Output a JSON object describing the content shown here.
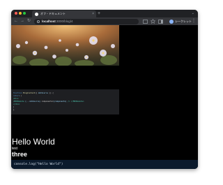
{
  "window": {
    "traffic_lights": {
      "close": "#ff5f57",
      "minimize": "#febc2e",
      "zoom": "#28c840"
    },
    "tab": {
      "title": "オフ・ドキュメント",
      "close_icon": "×"
    },
    "new_tab_icon": "+",
    "tab_menu_icon": "⌄"
  },
  "toolbar": {
    "back_icon": "←",
    "forward_icon": "→",
    "reload_icon": "↻",
    "address": {
      "host": "localhost",
      "port": ":3000/blog/4"
    },
    "profile_label": "シークレット",
    "menu_icon": "⋮"
  },
  "page": {
    "code": {
      "lines": [
        [
          {
            "t": "function",
            "c": "kw"
          },
          {
            "t": " BlogContent",
            "c": "fn"
          },
          {
            "t": "({ ",
            "c": "pu"
          },
          {
            "t": "mdxSource",
            "c": "tx"
          },
          {
            "t": " }) {",
            "c": "pu"
          }
        ],
        [
          {
            "t": "  return",
            "c": "kw"
          },
          {
            "t": " (",
            "c": "pu"
          }
        ],
        [
          {
            "t": "    <div>",
            "c": "tg"
          }
        ],
        [
          {
            "t": "      <MDXRemote",
            "c": "tg"
          },
          {
            "t": " {...mdxSource}",
            "c": "tx"
          },
          {
            "t": " components=",
            "c": "pu"
          },
          {
            "t": "{components}",
            "c": "tx"
          },
          {
            "t": " />",
            "c": "tg"
          },
          {
            "t": " </MDXRemote>",
            "c": "tg"
          }
        ],
        [
          {
            "t": "    </div>",
            "c": "tg"
          }
        ],
        [
          {
            "t": "  )",
            "c": "pu"
          }
        ],
        [
          {
            "t": "}",
            "c": "pu"
          }
        ]
      ]
    },
    "heading": "Hello World",
    "text_small": "test",
    "text_large": "three",
    "console": "console.log(\"Hello World\")"
  }
}
